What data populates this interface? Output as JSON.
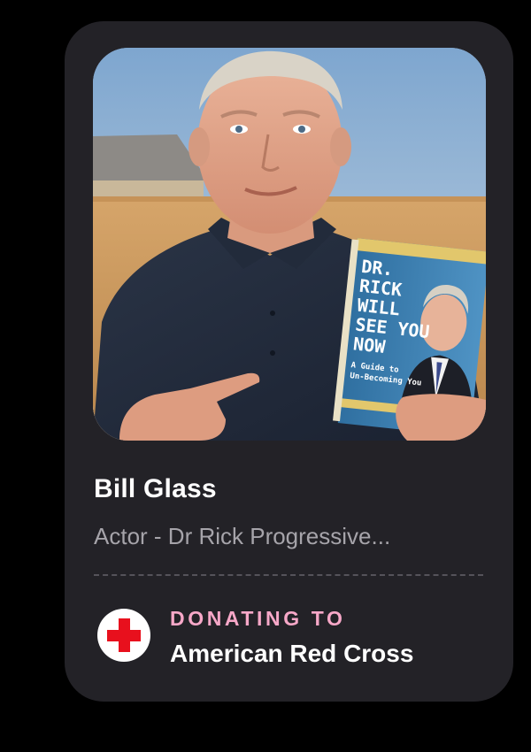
{
  "profile": {
    "name": "Bill Glass",
    "subtitle": "Actor - Dr Rick Progressive..."
  },
  "photo": {
    "book": {
      "title_lines": [
        "DR.",
        "RICK",
        "WILL",
        "SEE YOU",
        "NOW"
      ],
      "subtitle_lines": [
        "A Guide to",
        "Un-Becoming You"
      ]
    }
  },
  "donation": {
    "label": "DONATING TO",
    "cause": "American Red Cross",
    "logo_icon": "red-cross-icon"
  },
  "colors": {
    "background": "#000000",
    "card": "#232227",
    "label_pink": "#f7a8c8",
    "cross_red": "#e8101d"
  }
}
